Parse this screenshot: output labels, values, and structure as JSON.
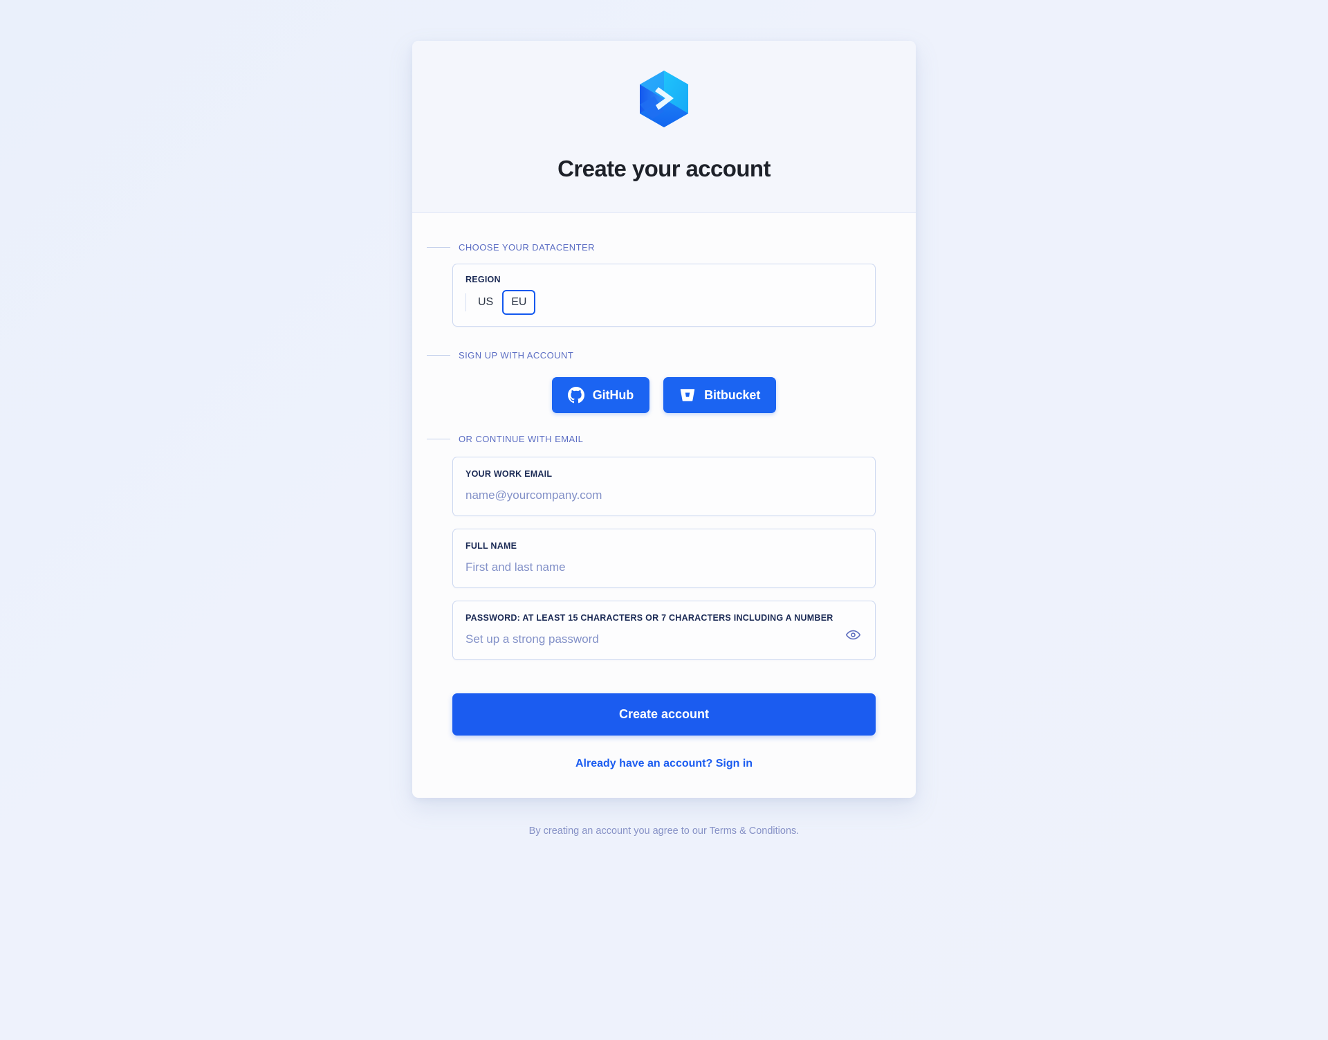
{
  "header": {
    "logo_icon": "hexagon-chevron-logo",
    "title": "Create your account"
  },
  "datacenter": {
    "section_label": "CHOOSE YOUR DATACENTER",
    "region_label": "REGION",
    "options": [
      {
        "label": "US",
        "selected": false
      },
      {
        "label": "EU",
        "selected": true
      }
    ]
  },
  "social": {
    "section_label": "SIGN UP WITH ACCOUNT",
    "buttons": [
      {
        "label": "GitHub",
        "icon": "github-icon"
      },
      {
        "label": "Bitbucket",
        "icon": "bitbucket-icon"
      }
    ]
  },
  "email_section": {
    "section_label": "OR CONTINUE WITH EMAIL",
    "fields": [
      {
        "label": "YOUR WORK EMAIL",
        "placeholder": "name@yourcompany.com",
        "value": ""
      },
      {
        "label": "FULL NAME",
        "placeholder": "First and last name",
        "value": ""
      },
      {
        "label": "PASSWORD: AT LEAST 15 CHARACTERS OR 7 CHARACTERS INCLUDING A NUMBER",
        "placeholder": "Set up a strong password",
        "value": "",
        "toggle_icon": "eye-icon"
      }
    ]
  },
  "actions": {
    "submit_label": "Create account",
    "signin_label": "Already have an account? Sign in"
  },
  "footer": {
    "text": "By creating an account you agree to our Terms & Conditions."
  },
  "colors": {
    "accent": "#1b64f2",
    "submit": "#1b5cf0",
    "section_label": "#5b6dc3",
    "field_border": "#ccd8f0",
    "page_bg": "#eef2fb",
    "header_bg": "#f4f6fc"
  }
}
